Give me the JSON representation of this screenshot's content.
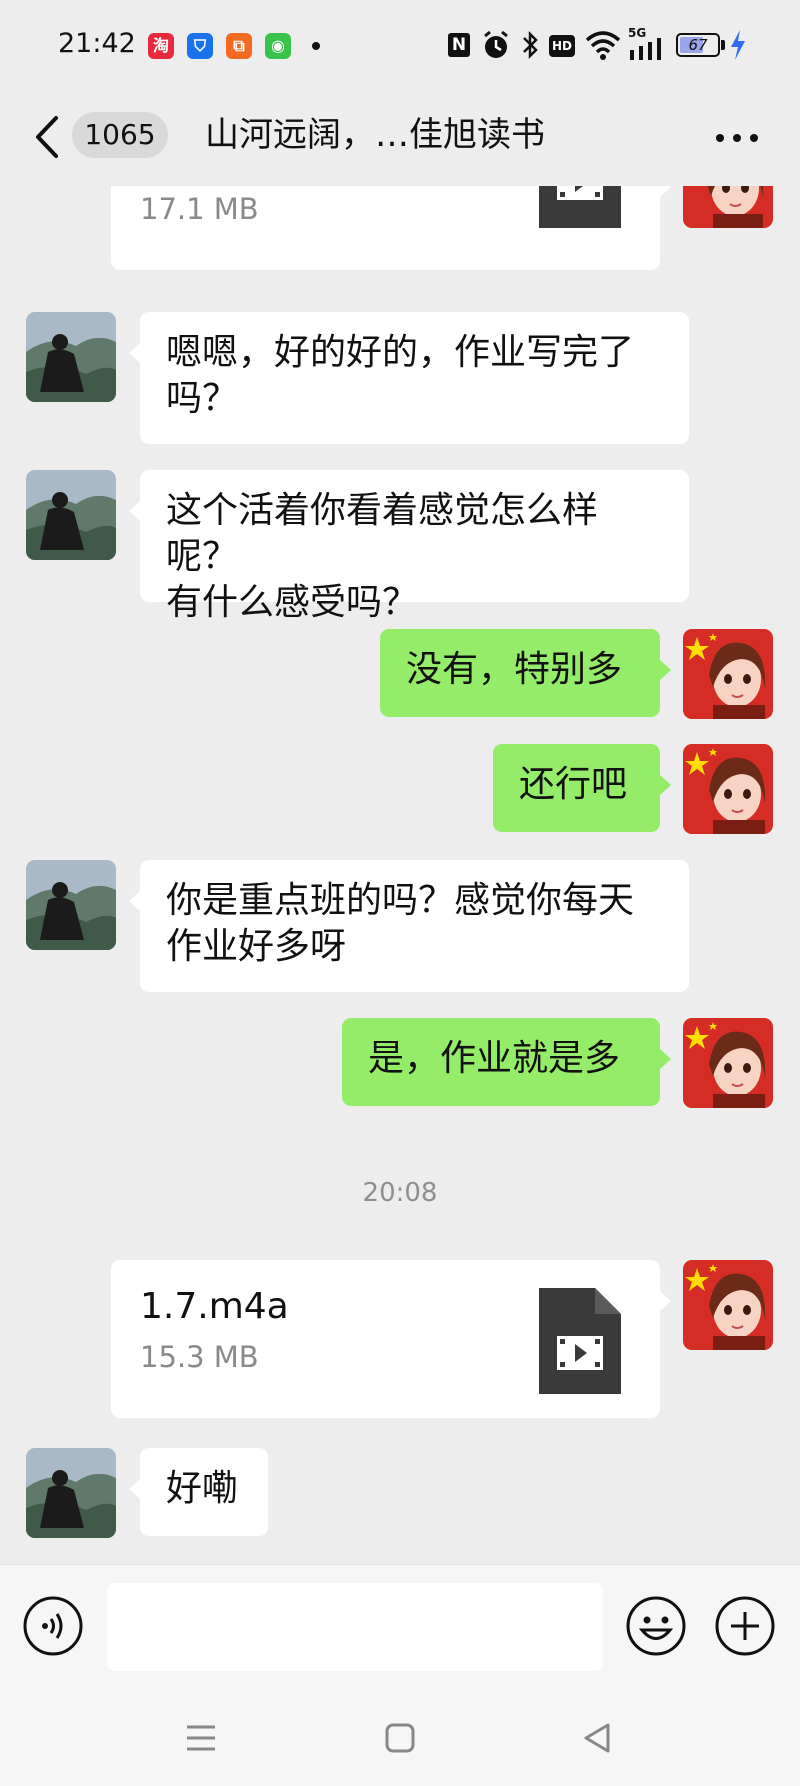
{
  "status_bar": {
    "time": "21:42",
    "apps": [
      {
        "name": "taobao-icon",
        "glyph": "淘",
        "color": "#e8283c"
      },
      {
        "name": "shield-app-icon",
        "glyph": "⛉",
        "color": "#1a73e8"
      },
      {
        "name": "orange-app-icon",
        "glyph": "⧉",
        "color": "#f26b21"
      },
      {
        "name": "android-app-icon",
        "glyph": "◉",
        "color": "#3ac34a"
      }
    ],
    "nfc": "N",
    "hd": "HD",
    "network": "5G",
    "battery": "67",
    "battery_level": 0.67
  },
  "header": {
    "unread_count": "1065",
    "title": "山河远阔，…佳旭读书"
  },
  "messages": [
    {
      "type": "file",
      "side": "out",
      "name": "",
      "size": "17.1 MB"
    },
    {
      "type": "text",
      "side": "in",
      "lines": [
        "嗯嗯，好的好的，作业写完了",
        "吗？"
      ]
    },
    {
      "type": "text",
      "side": "in",
      "lines": [
        "这个活着你看着感觉怎么样呢？",
        "有什么感受吗？"
      ]
    },
    {
      "type": "text",
      "side": "out",
      "lines": [
        "没有，特别多"
      ]
    },
    {
      "type": "text",
      "side": "out",
      "lines": [
        "还行吧"
      ]
    },
    {
      "type": "text",
      "side": "in",
      "lines": [
        "你是重点班的吗？感觉你每天",
        "作业好多呀"
      ]
    },
    {
      "type": "text",
      "side": "out",
      "lines": [
        "是，作业就是多"
      ]
    },
    {
      "type": "time",
      "text": "20:08"
    },
    {
      "type": "file",
      "side": "out",
      "name": "1.7.m4a",
      "size": "15.3 MB"
    },
    {
      "type": "text",
      "side": "in",
      "lines": [
        "好嘞"
      ]
    }
  ],
  "colors": {
    "background": "#ededed",
    "outgoing_bubble": "#95ec69",
    "incoming_bubble": "#ffffff"
  }
}
